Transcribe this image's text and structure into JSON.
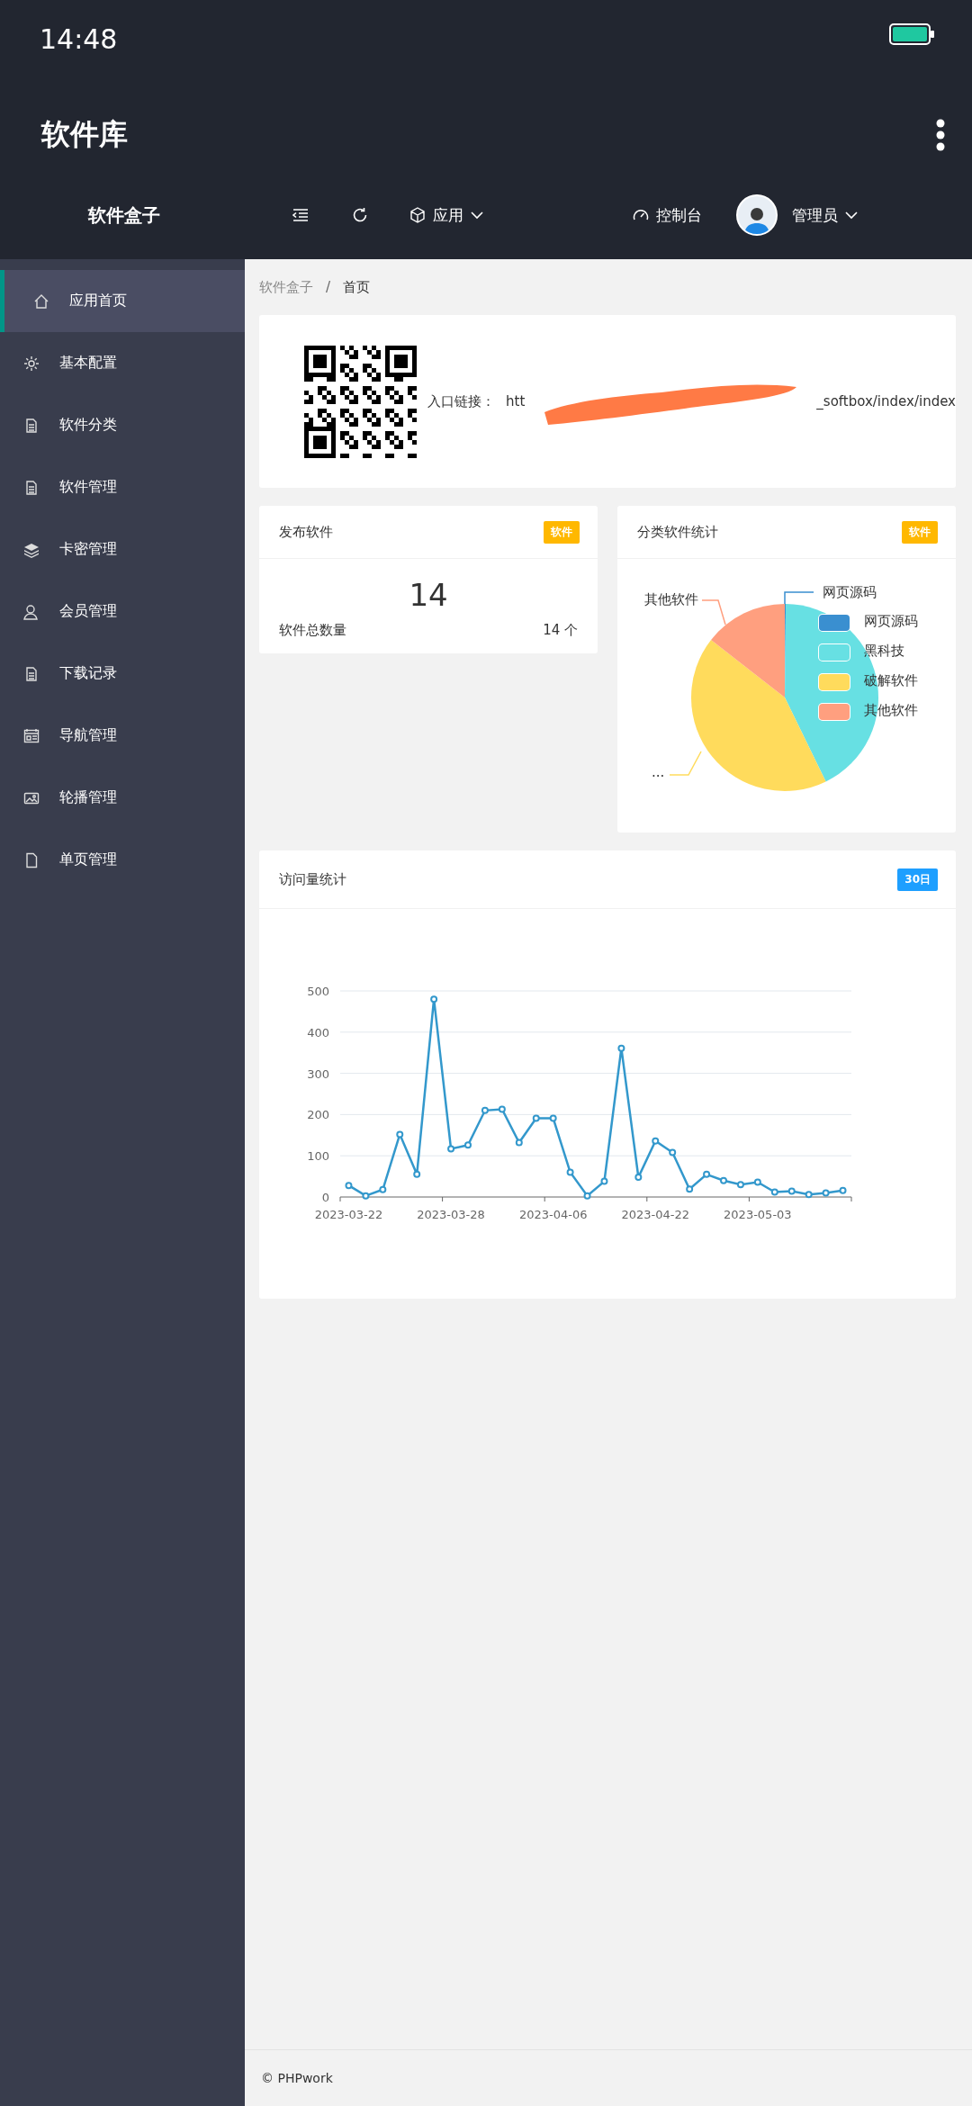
{
  "status_bar": {
    "time": "14:48"
  },
  "app_bar": {
    "title": "软件库"
  },
  "top_nav": {
    "brand": "软件盒子",
    "apps_menu": "应用",
    "console": "控制台",
    "user": "管理员"
  },
  "sidebar": {
    "items": [
      {
        "label": "应用首页",
        "selected": true
      },
      {
        "label": "基本配置",
        "selected": false
      },
      {
        "label": "软件分类",
        "selected": false
      },
      {
        "label": "软件管理",
        "selected": false
      },
      {
        "label": "卡密管理",
        "selected": false
      },
      {
        "label": "会员管理",
        "selected": false
      },
      {
        "label": "下载记录",
        "selected": false
      },
      {
        "label": "导航管理",
        "selected": false
      },
      {
        "label": "轮播管理",
        "selected": false
      },
      {
        "label": "单页管理",
        "selected": false
      }
    ]
  },
  "breadcrumb": {
    "items": [
      "软件盒子",
      "首页"
    ],
    "separator": "/"
  },
  "entry_card": {
    "label": "入口链接：",
    "url_start": "htt",
    "url_end": "_softbox/index/index"
  },
  "publish_card": {
    "title": "发布软件",
    "badge": "软件",
    "count": "14",
    "total_label": "软件总数量",
    "total_value": "14 个"
  },
  "category_card": {
    "title": "分类软件统计",
    "badge": "软件",
    "slice_labels": [
      {
        "text": "网页源码"
      },
      {
        "text": "其他软件"
      },
      {
        "text": "..."
      }
    ],
    "legend": [
      {
        "label": "网页源码",
        "color": "#3a8fd0"
      },
      {
        "label": "黑科技",
        "color": "#67e0e3"
      },
      {
        "label": "破解软件",
        "color": "#ffdb5c"
      },
      {
        "label": "其他软件",
        "color": "#ff9f7f"
      }
    ]
  },
  "visits_card": {
    "title": "访问量统计",
    "badge": "30日",
    "chart_data": {
      "type": "line",
      "categories": [
        "2023-03-22",
        null,
        null,
        null,
        null,
        null,
        "2023-03-28",
        null,
        null,
        null,
        null,
        null,
        "2023-04-06",
        null,
        null,
        null,
        null,
        null,
        "2023-04-22",
        null,
        null,
        null,
        null,
        null,
        "2023-05-03",
        null,
        null,
        null,
        null,
        null
      ],
      "series": [
        {
          "color": "#3398cc",
          "marker": "circle",
          "values": [
            28,
            3,
            18,
            152,
            55,
            480,
            117,
            126,
            210,
            213,
            132,
            191,
            191,
            60,
            3,
            38,
            361,
            48,
            136,
            108,
            19,
            55,
            40,
            30,
            36,
            12,
            14,
            6,
            10,
            16
          ]
        }
      ],
      "ylim": [
        0,
        500
      ],
      "yticks": [
        0,
        100,
        200,
        300,
        400,
        500
      ],
      "grid": true
    }
  },
  "footer": {
    "text": "© PHPwork"
  }
}
